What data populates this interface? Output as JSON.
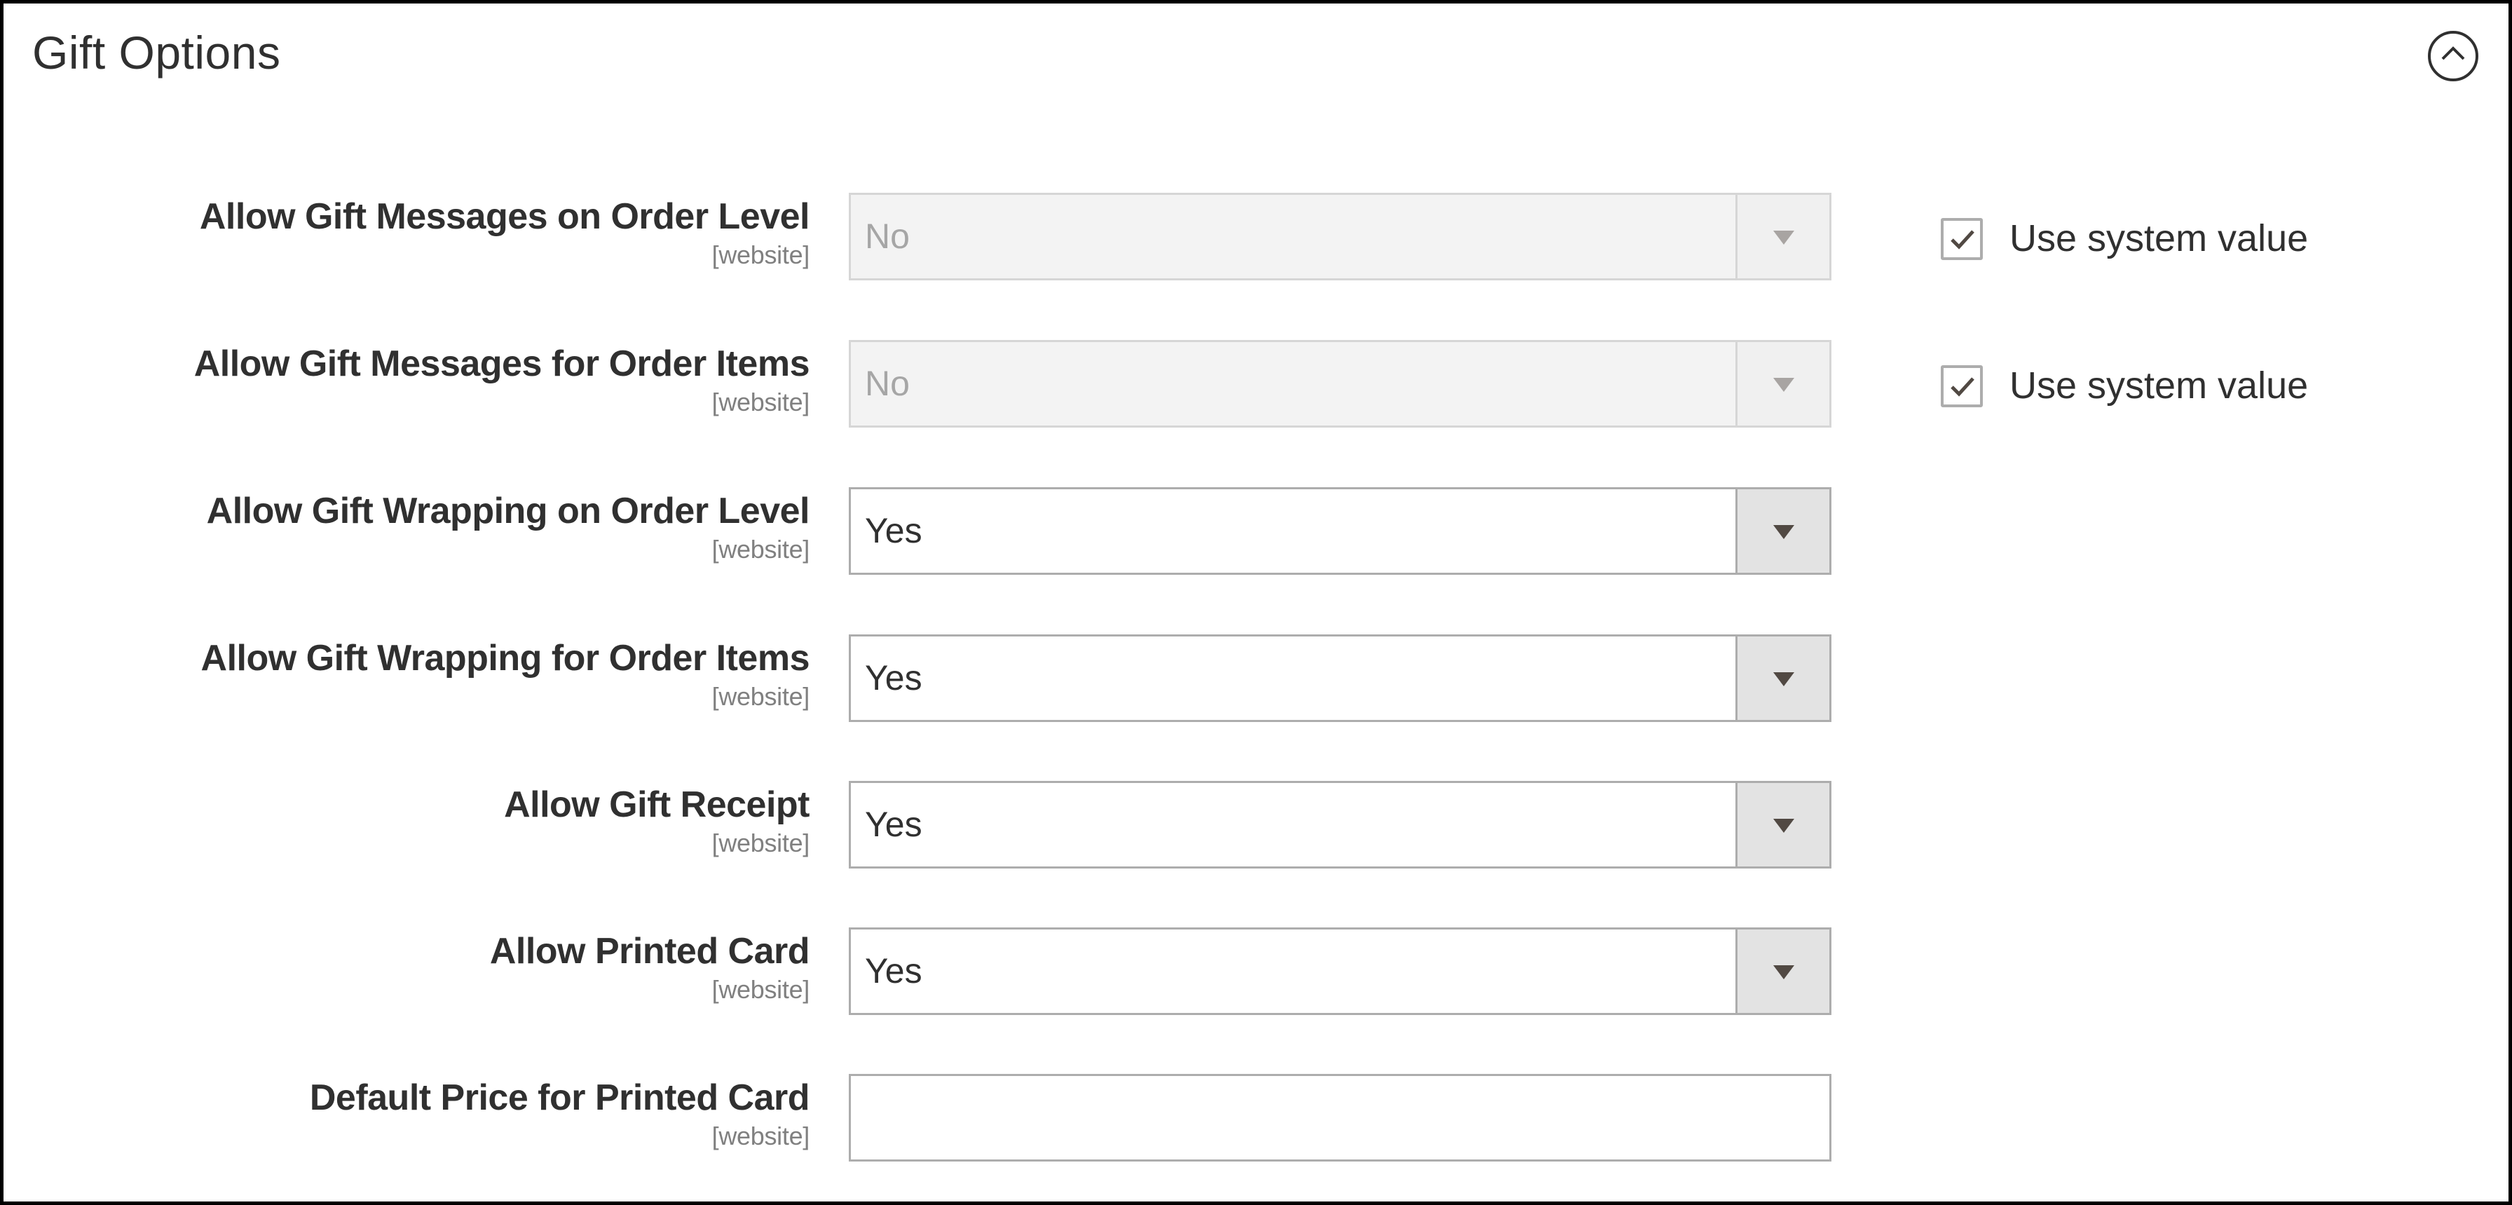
{
  "section": {
    "title": "Gift Options",
    "collapse_icon": "chevron-up-circle-icon",
    "expanded": true
  },
  "fields": [
    {
      "label": "Allow Gift Messages on Order Level",
      "scope": "[website]",
      "type": "select",
      "value": "No",
      "disabled": true,
      "use_system_value": true,
      "use_system_value_label": "Use system value"
    },
    {
      "label": "Allow Gift Messages for Order Items",
      "scope": "[website]",
      "type": "select",
      "value": "No",
      "disabled": true,
      "use_system_value": true,
      "use_system_value_label": "Use system value"
    },
    {
      "label": "Allow Gift Wrapping on Order Level",
      "scope": "[website]",
      "type": "select",
      "value": "Yes",
      "disabled": false
    },
    {
      "label": "Allow Gift Wrapping for Order Items",
      "scope": "[website]",
      "type": "select",
      "value": "Yes",
      "disabled": false
    },
    {
      "label": "Allow Gift Receipt",
      "scope": "[website]",
      "type": "select",
      "value": "Yes",
      "disabled": false
    },
    {
      "label": "Allow Printed Card",
      "scope": "[website]",
      "type": "select",
      "value": "Yes",
      "disabled": false
    },
    {
      "label": "Default Price for Printed Card",
      "scope": "[website]",
      "type": "text",
      "value": "",
      "placeholder": ""
    }
  ],
  "colors": {
    "text": "#303030",
    "scope_text": "#808080",
    "border": "#adadad",
    "disabled_bg": "#f3f3f3",
    "arrow_bg": "#e3e3e3",
    "arrow": "#514943"
  }
}
